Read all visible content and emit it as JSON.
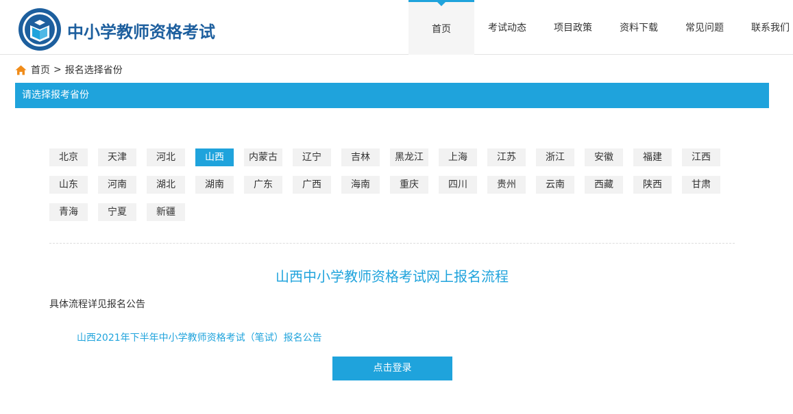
{
  "header": {
    "site_title": "中小学教师资格考试",
    "nav": [
      {
        "label": "首页",
        "active": true
      },
      {
        "label": "考试动态"
      },
      {
        "label": "项目政策"
      },
      {
        "label": "资料下载"
      },
      {
        "label": "常见问题"
      },
      {
        "label": "联系我们"
      }
    ],
    "logo_icon": "book-seal-logo"
  },
  "breadcrumb": {
    "home": "首页",
    "separator": ">",
    "current": "报名选择省份",
    "home_icon": "house-icon"
  },
  "section": {
    "title": "请选择报考省份"
  },
  "provinces": {
    "rows": [
      [
        "北京",
        "天津",
        "河北",
        "山西",
        "内蒙古",
        "辽宁",
        "吉林",
        "黑龙江",
        "上海",
        "江苏",
        "浙江",
        "安徽",
        "福建",
        "江西"
      ],
      [
        "山东",
        "河南",
        "湖北",
        "湖南",
        "广东",
        "广西",
        "海南",
        "重庆",
        "四川",
        "贵州",
        "云南",
        "西藏",
        "陕西",
        "甘肃"
      ],
      [
        "青海",
        "宁夏",
        "新疆"
      ]
    ],
    "selected": "山西"
  },
  "flow": {
    "title": "山西中小学教师资格考试网上报名流程",
    "desc": "具体流程详见报名公告",
    "notice_link": "山西2021年下半年中小学教师资格考试（笔试）报名公告",
    "login_button": "点击登录"
  },
  "colors": {
    "accent": "#1fa3dc",
    "brand_title": "#1d5f9e",
    "chip_bg": "#f2f2f2"
  }
}
